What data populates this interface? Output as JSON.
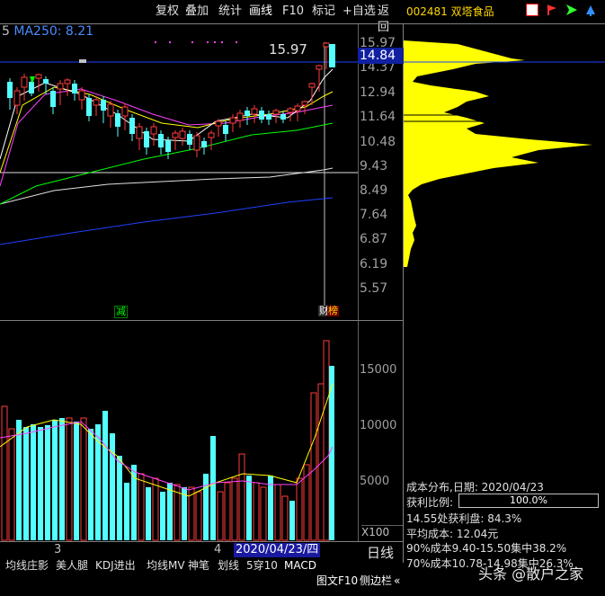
{
  "toolbar": {
    "buttons": [
      "复权",
      "叠加",
      "统计",
      "画线",
      "F10",
      "标记",
      "+自选",
      "返回"
    ],
    "active": "画线"
  },
  "stock": {
    "code": "002481",
    "name": "双塔食品"
  },
  "ma_label": "MA250: 8.21",
  "ma_prefix": "5",
  "price_axis": [
    "15.97",
    "14.37",
    "12.94",
    "11.64",
    "10.48",
    "9.43",
    "8.49",
    "7.64",
    "6.87",
    "6.19",
    "5.57"
  ],
  "current_price": "14.84",
  "peak_label": "15.97",
  "markers": {
    "reduce": "减",
    "report": "财",
    "rank": "榜"
  },
  "volume_axis": [
    "15000",
    "10000",
    "5000"
  ],
  "volume_unit": "X100",
  "dates": {
    "month_a": "3",
    "month_b": "4",
    "selected": "2020/04/23/四",
    "period": "日线"
  },
  "tabs": [
    "均线庄影",
    "美人腿",
    "KDJ进出",
    "均线MV",
    "神笔",
    "划线",
    "5穿10",
    "MACD"
  ],
  "rail": [
    "图文F10",
    "侧边栏",
    "«"
  ],
  "chip": {
    "title": "成本分布,日期: 2020/04/23",
    "profit_ratio_label": "获利比例:",
    "profit_ratio": "100.0%",
    "profit_ratio_value": 1.0,
    "line1": "14.55处获利盘: 84.3%",
    "line2": "平均成本: 12.04元",
    "line3": "90%成本9.40-15.50集中38.2%",
    "line4": "70%成本10.78-14.98集中26.3%"
  },
  "watermark": "头条 @散户之家",
  "colors": {
    "up": "#ff3c3c",
    "down": "#54ffff",
    "chip": "#ffff00",
    "ma5": "#ffffff",
    "ma10": "#ffff00",
    "ma20": "#ff40ff",
    "ma60": "#00ff00",
    "ma120": "#e0e0e0",
    "ma250": "#2040ff"
  }
}
